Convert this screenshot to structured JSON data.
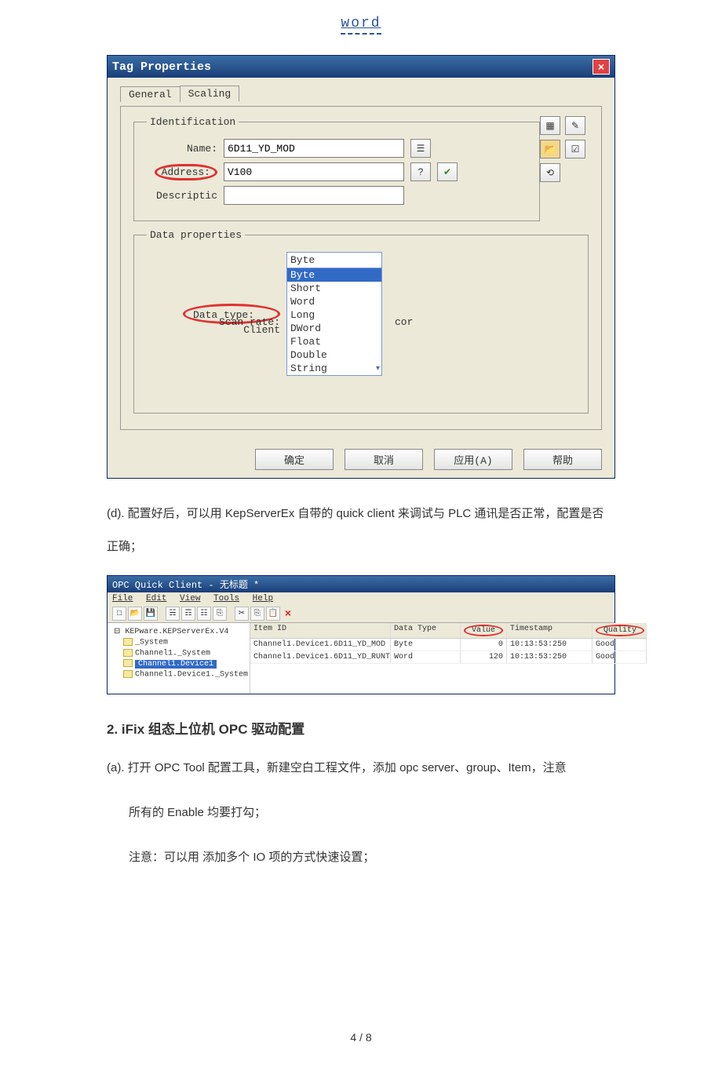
{
  "header_link": "word",
  "tag_dialog": {
    "title": "Tag Properties",
    "tabs": {
      "general": "General",
      "scaling": "Scaling"
    },
    "identification": {
      "legend": "Identification",
      "name_label": "Name:",
      "name_value": "6D11_YD_MOD",
      "address_label": "Address:",
      "address_value": "V100",
      "description_label": "Descriptic"
    },
    "data_properties": {
      "legend": "Data properties",
      "data_type_label": "Data type:",
      "data_type_selected": "Byte",
      "client_label": "Client",
      "scan_rate_label": "Scan rate:",
      "scan_rate_suffix": "cor",
      "options": [
        "Byte",
        "Short",
        "Word",
        "Long",
        "DWord",
        "Float",
        "Double",
        "String"
      ]
    },
    "buttons": {
      "ok": "确定",
      "cancel": "取消",
      "apply": "应用(A)",
      "help": "帮助"
    }
  },
  "para_d": "(d). 配置好后，可以用 KepServerEx 自带的 quick client 来调试与 PLC 通讯是否正常，配置是否正确；",
  "quick_client": {
    "title": "OPC Quick Client - 无标题 *",
    "menu": [
      "File",
      "Edit",
      "View",
      "Tools",
      "Help"
    ],
    "tree": {
      "root": "KEPware.KEPServerEx.V4",
      "n1": "_System",
      "n2": "Channel1._System",
      "n3": "Channel1.Device1",
      "n4": "Channel1.Device1._System"
    },
    "headers": {
      "id": "Item ID",
      "dt": "Data Type",
      "val": "Value",
      "ts": "Timestamp",
      "q": "Quality"
    },
    "rows": [
      {
        "id": "Channel1.Device1.6D11_YD_MOD",
        "dt": "Byte",
        "val": "0",
        "ts": "10:13:53:250",
        "q": "Good"
      },
      {
        "id": "Channel1.Device1.6D11_YD_RUNT",
        "dt": "Word",
        "val": "120",
        "ts": "10:13:53:250",
        "q": "Good"
      }
    ]
  },
  "section2_title": "2. iFix 组态上位机 OPC 驱动配置",
  "para_a": "(a). 打开 OPC Tool 配置工具，新建空白工程文件，添加 opc server、group、Item，注意",
  "para_a_sub1": "所有的 Enable 均要打勾；",
  "para_a_sub2": "注意：可以用   添加多个 IO 项的方式快速设置；",
  "footer": "4 / 8"
}
